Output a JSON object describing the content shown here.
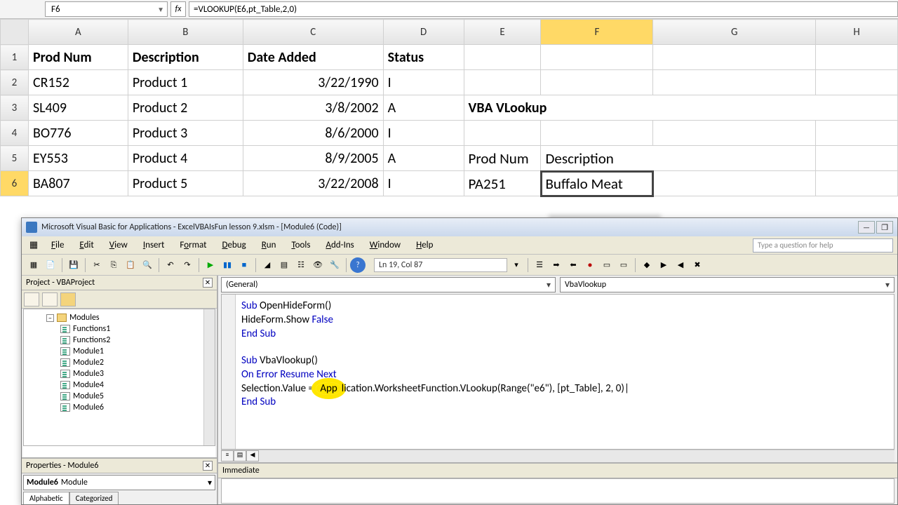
{
  "formula_bar": {
    "cell_ref": "F6",
    "fx_label": "fx",
    "formula": "=VLOOKUP(E6,pt_Table,2,0)"
  },
  "columns": [
    "A",
    "B",
    "C",
    "D",
    "E",
    "F",
    "G",
    "H"
  ],
  "selected_col": "F",
  "selected_row": "6",
  "sheet": {
    "headers": {
      "a": "Prod Num",
      "b": "Description",
      "c": "Date Added",
      "d": "Status"
    },
    "rows": [
      {
        "num": "1"
      },
      {
        "num": "2",
        "a": "CR152",
        "b": "Product 1",
        "c": "3/22/1990",
        "d": "I"
      },
      {
        "num": "3",
        "a": "SL409",
        "b": "Product 2",
        "c": "3/8/2002",
        "d": "A"
      },
      {
        "num": "4",
        "a": "BO776",
        "b": "Product 3",
        "c": "8/6/2000",
        "d": "I"
      },
      {
        "num": "5",
        "a": "EY553",
        "b": "Product 4",
        "c": "8/9/2005",
        "d": "A"
      },
      {
        "num": "6",
        "a": "BA807",
        "b": "Product 5",
        "c": "3/22/2008",
        "d": "I"
      }
    ],
    "title": "VBA VLookup",
    "lookup": {
      "hn": "Prod Num",
      "hd": "Description",
      "num": "PA251",
      "desc": "Buffalo Meat"
    }
  },
  "vbe": {
    "title": "Microsoft Visual Basic for Applications - ExcelVBAIsFun lesson 9.xlsm - [Module6 (Code)]",
    "menu": [
      "File",
      "Edit",
      "View",
      "Insert",
      "Format",
      "Debug",
      "Run",
      "Tools",
      "Add-Ins",
      "Window",
      "Help"
    ],
    "ask_placeholder": "Type a question for help",
    "cursor_pos": "Ln 19, Col 87",
    "project_title": "Project - VBAProject",
    "modules_label": "Modules",
    "modules": [
      "Functions1",
      "Functions2",
      "Module1",
      "Module2",
      "Module3",
      "Module4",
      "Module5",
      "Module6"
    ],
    "props_title": "Properties - Module6",
    "props_combo_bold": "Module6",
    "props_combo_rest": "Module",
    "props_tabs": [
      "Alphabetic",
      "Categorized"
    ],
    "code_obj": "(General)",
    "code_proc": "VbaVlookup",
    "code": {
      "l1a": "Sub",
      "l1b": " OpenHideForm()",
      "l2a": "HideForm.Show ",
      "l2b": "False",
      "l3": "End Sub",
      "l4a": "Sub",
      "l4b": " VbaVlookup()",
      "l5": "On Error Resume Next",
      "l6a": "Selection.Value = ",
      "l6h": "App",
      "l6b": "lication.WorksheetFunction.VLookup(Range(\"e6\"), [pt_Table], 2, 0)|",
      "l7": "End Sub"
    },
    "immediate_title": "Immediate"
  }
}
